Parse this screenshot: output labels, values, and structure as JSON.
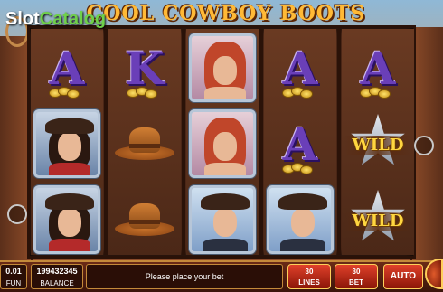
{
  "title": "COOL COWBOY BOOTS",
  "watermark": {
    "slot": "Slot",
    "catalog": "Catalog"
  },
  "reels": [
    {
      "symbols": [
        "A",
        "cowgirl",
        "cowgirl"
      ]
    },
    {
      "symbols": [
        "K",
        "cowboy-hat",
        "cowboy-hat"
      ]
    },
    {
      "symbols": [
        "redhead",
        "redhead",
        "sheriff"
      ]
    },
    {
      "symbols": [
        "A",
        "A",
        "sheriff"
      ]
    },
    {
      "symbols": [
        "A",
        "wild",
        "wild"
      ]
    }
  ],
  "wild_label": "WILD",
  "bottom": {
    "fun_value": "0.01",
    "fun_label": "FUN",
    "balance_value": "199432345",
    "balance_label": "BALANCE",
    "message": "Please place your bet",
    "lines_value": "30",
    "lines_label": "LINES",
    "bet_value": "30",
    "bet_label": "BET",
    "auto_label": "AUTO"
  },
  "colors": {
    "letter": "#6a3fb8",
    "title": "#ffb936",
    "wild": "#ffd640",
    "accent": "#6fd04a"
  }
}
